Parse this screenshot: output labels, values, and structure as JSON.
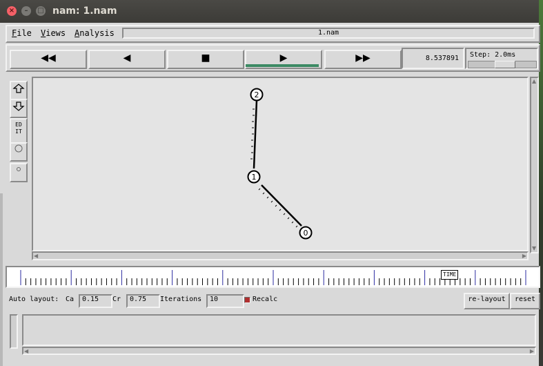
{
  "window": {
    "title": "nam: 1.nam"
  },
  "menu": {
    "file": "File",
    "file_rest": "ile",
    "views": "Views",
    "views_rest": "iews",
    "analysis": "Analysis",
    "analysis_rest": "nalysis"
  },
  "file_name": "1.nam",
  "playback": {
    "rewind": "◀◀",
    "back": "◀",
    "stop": "■",
    "play": "▶",
    "fast_forward": "▶▶",
    "time": "8.537891",
    "step_label": "Step: 2.0ms"
  },
  "toolbar": {
    "edit_label_1": "ED",
    "edit_label_2": "IT"
  },
  "topology": {
    "nodes": [
      {
        "id": "0"
      },
      {
        "id": "1"
      },
      {
        "id": "2"
      }
    ],
    "links": [
      [
        "2",
        "1"
      ],
      [
        "1",
        "0"
      ]
    ]
  },
  "timeline": {
    "marker_label": "TIME"
  },
  "auto_layout": {
    "label": "Auto layout:",
    "ca_label": "Ca",
    "ca_value": "0.15",
    "cr_label": "Cr",
    "cr_value": "0.75",
    "iterations_label": "Iterations",
    "iterations_value": "10",
    "recalc_label": "Recalc",
    "relayout_label": "re-layout",
    "reset_label": "reset"
  },
  "colors": {
    "play_indicator": "#3c8a64",
    "timeline_major_tick": "#2a2aa0"
  }
}
